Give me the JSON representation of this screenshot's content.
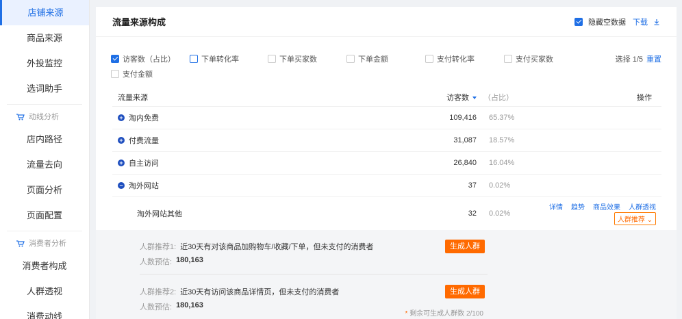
{
  "sidebar": {
    "items_top": [
      {
        "label": "店铺来源",
        "active": true
      },
      {
        "label": "商品来源"
      },
      {
        "label": "外投监控"
      },
      {
        "label": "选词助手"
      }
    ],
    "section1": {
      "label": "动线分析",
      "icon": "cart-icon"
    },
    "items_mid": [
      {
        "label": "店内路径"
      },
      {
        "label": "流量去向"
      },
      {
        "label": "页面分析"
      },
      {
        "label": "页面配置"
      }
    ],
    "section2": {
      "label": "消费者分析",
      "icon": "cart-icon"
    },
    "items_bot": [
      {
        "label": "消费者构成"
      },
      {
        "label": "人群透视"
      },
      {
        "label": "消费动线"
      }
    ]
  },
  "header": {
    "title": "流量来源构成",
    "hide_empty_label": "隐藏空数据",
    "download_label": "下载"
  },
  "metrics": [
    {
      "label": "访客数（占比）",
      "checked": true
    },
    {
      "label": "下单转化率",
      "checked": false,
      "highlight": true
    },
    {
      "label": "下单买家数",
      "checked": false
    },
    {
      "label": "下单金额",
      "checked": false
    },
    {
      "label": "支付转化率",
      "checked": false
    },
    {
      "label": "支付买家数",
      "checked": false
    },
    {
      "label": "支付金额",
      "checked": false
    }
  ],
  "selection": {
    "text": "选择 1/5",
    "reset_label": "重置"
  },
  "table": {
    "col_source": "流量来源",
    "col_visitors": "访客数",
    "col_pct": "（占比）",
    "col_op": "操作",
    "rows": [
      {
        "name": "淘内免费",
        "visitors": "109,416",
        "pct": "65.37%",
        "expand": "+"
      },
      {
        "name": "付费流量",
        "visitors": "31,087",
        "pct": "18.57%",
        "expand": "+"
      },
      {
        "name": "自主访问",
        "visitors": "26,840",
        "pct": "16.04%",
        "expand": "+"
      },
      {
        "name": "淘外网站",
        "visitors": "37",
        "pct": "0.02%",
        "expand": "−"
      }
    ],
    "sub_row": {
      "name": "淘外网站其他",
      "visitors": "32",
      "pct": "0.02%",
      "ops": [
        "详情",
        "趋势",
        "商品效果",
        "人群透视"
      ],
      "recommend_label": "人群推荐"
    }
  },
  "recommend": {
    "item1": {
      "label": "人群推荐1:",
      "desc": "近30天有对该商品加购物车/收藏/下单，但未支付的消费者",
      "est_label": "人数预估:",
      "est_value": "180,163",
      "button": "生成人群"
    },
    "item2": {
      "label": "人群推荐2:",
      "desc": "近30天有访问该商品详情页，但未支付的消费者",
      "est_label": "人数预估:",
      "est_value": "180,163",
      "button": "生成人群"
    },
    "remain": "剩余可生成人群数 2/100",
    "remain_star": "*"
  }
}
